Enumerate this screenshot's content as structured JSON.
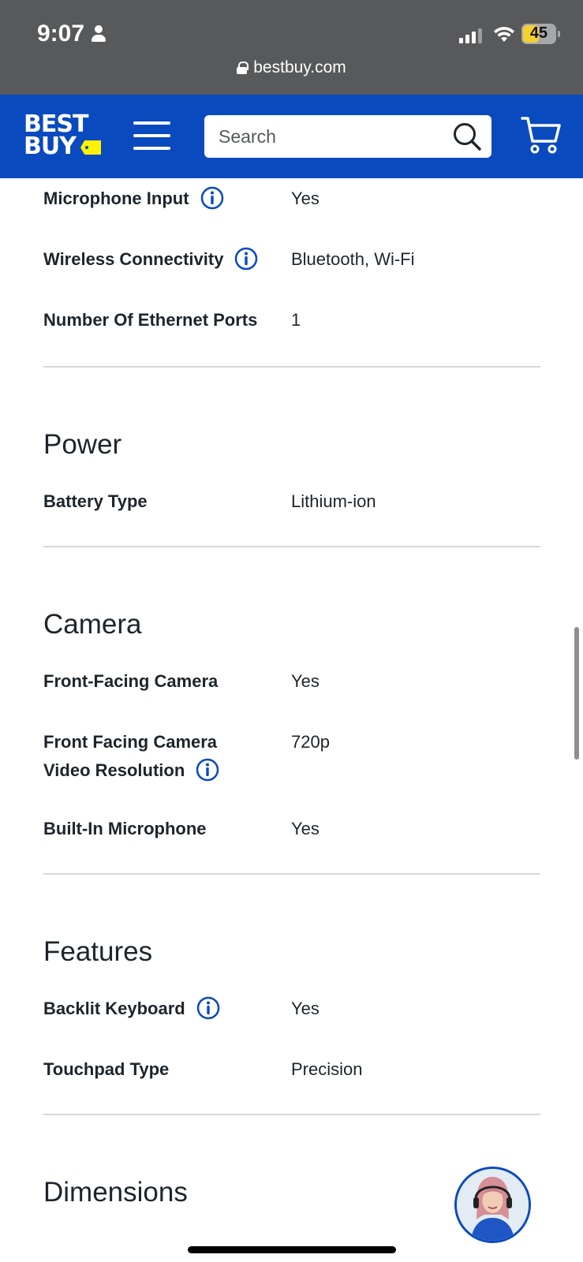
{
  "status_bar": {
    "time": "9:07",
    "battery": "45",
    "url": "bestbuy.com"
  },
  "header": {
    "logo_line1": "BEST",
    "logo_line2": "BUY",
    "search_placeholder": "Search",
    "colors": {
      "brand_blue": "#0a4abf",
      "tag_yellow": "#fff200"
    }
  },
  "specs": {
    "connectivity_rows": [
      {
        "label": "Microphone Input",
        "value": "Yes"
      },
      {
        "label": "Wireless Connectivity",
        "value": "Bluetooth, Wi-Fi"
      },
      {
        "label": "Number Of Ethernet Ports",
        "value": "1"
      }
    ],
    "power": {
      "title": "Power",
      "rows": [
        {
          "label": "Battery Type",
          "value": "Lithium-ion"
        }
      ]
    },
    "camera": {
      "title": "Camera",
      "rows": [
        {
          "label": "Front-Facing Camera",
          "value": "Yes"
        },
        {
          "label_line1": "Front Facing Camera",
          "label_line2": "Video Resolution",
          "value": "720p"
        },
        {
          "label": "Built-In Microphone",
          "value": "Yes"
        }
      ]
    },
    "features": {
      "title": "Features",
      "rows": [
        {
          "label": "Backlit Keyboard",
          "value": "Yes"
        },
        {
          "label": "Touchpad Type",
          "value": "Precision"
        }
      ]
    },
    "dimensions": {
      "title": "Dimensions"
    }
  }
}
